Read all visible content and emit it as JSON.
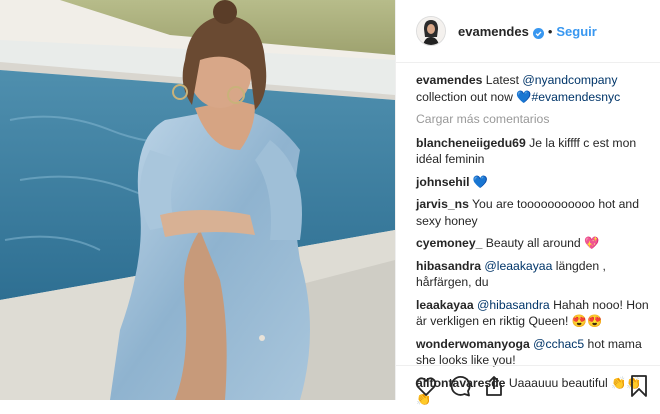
{
  "header": {
    "username": "evamendes",
    "separator": "•",
    "follow_label": "Seguir",
    "verified_icon": "verified-badge-icon"
  },
  "caption": {
    "username": "evamendes",
    "text_before": "Latest ",
    "mention": "@nyandcompany",
    "text_after": " collection out now ",
    "emoji": "💙",
    "hashtag": "#evamendesnyc"
  },
  "load_more_label": "Cargar más comentarios",
  "comments": [
    {
      "username": "blancheneiigedu69",
      "mention": "",
      "text": "Je la kiffff c est mon idéal feminin",
      "emoji": ""
    },
    {
      "username": "johnsehil",
      "mention": "",
      "text": "",
      "emoji": "💙"
    },
    {
      "username": "jarvis_ns",
      "mention": "",
      "text": "You are tooooooooooo hot and sexy honey",
      "emoji": ""
    },
    {
      "username": "cyemoney_",
      "mention": "",
      "text": "Beauty all around",
      "emoji": "💖"
    },
    {
      "username": "hibasandra",
      "mention": "@leaakayaa",
      "text": "längden , hårfärgen, du",
      "emoji": ""
    },
    {
      "username": "leaakayaa",
      "mention": "@hibasandra",
      "text": "Hahah nooo! Hon är verkligen en riktig Queen!",
      "emoji": "😍😍"
    },
    {
      "username": "wonderwomanyoga",
      "mention": "@cchac5",
      "text": "hot mama she looks like you!",
      "emoji": ""
    },
    {
      "username": "ailtontavaresde",
      "mention": "",
      "text": "Uaaauuu beautiful",
      "emoji": "👏👏👏"
    }
  ],
  "actions": {
    "like_icon": "heart-icon",
    "comment_icon": "comment-icon",
    "share_icon": "share-icon",
    "save_icon": "bookmark-icon"
  },
  "colors": {
    "link": "#3897f0",
    "mention": "#003569",
    "muted": "#999999",
    "text": "#262626"
  }
}
